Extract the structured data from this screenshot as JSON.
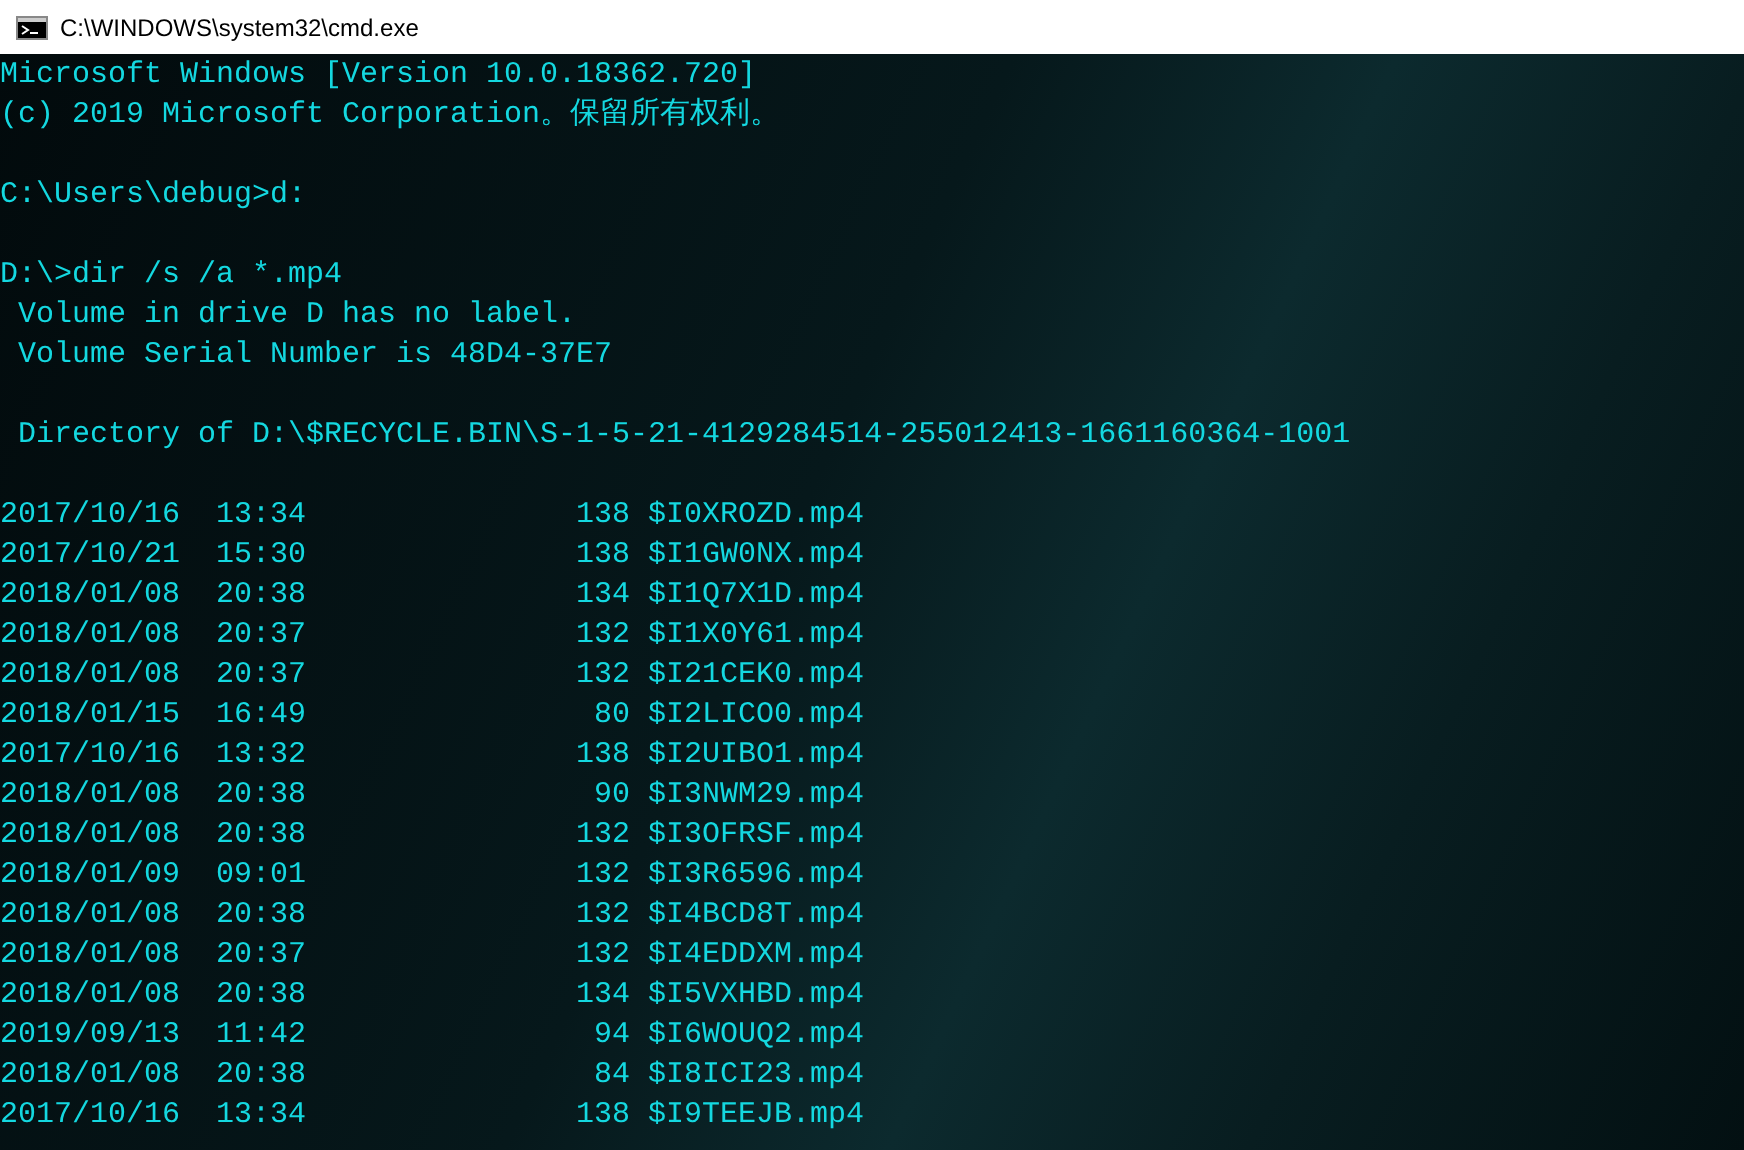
{
  "window": {
    "title": "C:\\WINDOWS\\system32\\cmd.exe"
  },
  "blocks": [
    {
      "lines": [
        "Microsoft Windows [Version 10.0.18362.720]",
        "(c) 2019 Microsoft Corporation。保留所有权利。"
      ]
    },
    {
      "lines": [
        "C:\\Users\\debug>d:"
      ]
    },
    {
      "lines": [
        "D:\\>dir /s /a *.mp4",
        " Volume in drive D has no label.",
        " Volume Serial Number is 48D4-37E7"
      ]
    },
    {
      "lines": [
        " Directory of D:\\$RECYCLE.BIN\\S-1-5-21-4129284514-255012413-1661160364-1001"
      ]
    }
  ],
  "files": [
    {
      "date": "2017/10/16",
      "time": "13:34",
      "size": "138",
      "name": "$I0XROZD.mp4"
    },
    {
      "date": "2017/10/21",
      "time": "15:30",
      "size": "138",
      "name": "$I1GW0NX.mp4"
    },
    {
      "date": "2018/01/08",
      "time": "20:38",
      "size": "134",
      "name": "$I1Q7X1D.mp4"
    },
    {
      "date": "2018/01/08",
      "time": "20:37",
      "size": "132",
      "name": "$I1X0Y61.mp4"
    },
    {
      "date": "2018/01/08",
      "time": "20:37",
      "size": "132",
      "name": "$I21CEK0.mp4"
    },
    {
      "date": "2018/01/15",
      "time": "16:49",
      "size": "80",
      "name": "$I2LICO0.mp4"
    },
    {
      "date": "2017/10/16",
      "time": "13:32",
      "size": "138",
      "name": "$I2UIBO1.mp4"
    },
    {
      "date": "2018/01/08",
      "time": "20:38",
      "size": "90",
      "name": "$I3NWM29.mp4"
    },
    {
      "date": "2018/01/08",
      "time": "20:38",
      "size": "132",
      "name": "$I3OFRSF.mp4"
    },
    {
      "date": "2018/01/09",
      "time": "09:01",
      "size": "132",
      "name": "$I3R6596.mp4"
    },
    {
      "date": "2018/01/08",
      "time": "20:38",
      "size": "132",
      "name": "$I4BCD8T.mp4"
    },
    {
      "date": "2018/01/08",
      "time": "20:37",
      "size": "132",
      "name": "$I4EDDXM.mp4"
    },
    {
      "date": "2018/01/08",
      "time": "20:38",
      "size": "134",
      "name": "$I5VXHBD.mp4"
    },
    {
      "date": "2019/09/13",
      "time": "11:42",
      "size": "94",
      "name": "$I6WOUQ2.mp4"
    },
    {
      "date": "2018/01/08",
      "time": "20:38",
      "size": "84",
      "name": "$I8ICI23.mp4"
    },
    {
      "date": "2017/10/16",
      "time": "13:34",
      "size": "138",
      "name": "$I9TEEJB.mp4"
    }
  ]
}
